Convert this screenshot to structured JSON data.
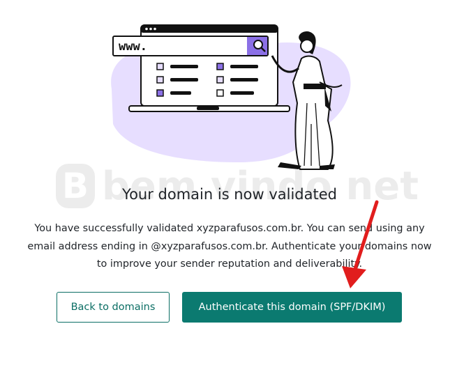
{
  "illustration": {
    "url_text": "www."
  },
  "watermark": {
    "logo_letter": "B",
    "text": "bem vindo net"
  },
  "headline": "Your domain is now validated",
  "description": "You have successfully validated xyzparafusos.com.br. You can send using any email address ending in @xyzparafusos.com.br. Authenticate your domains now to improve your sender reputation and deliverability.",
  "buttons": {
    "back_label": "Back to domains",
    "authenticate_label": "Authenticate this domain (SPF/DKIM)"
  },
  "colors": {
    "primary": "#0b7a70",
    "illustration_purple": "#8b70e6",
    "blob": "#e7deff",
    "annotation_arrow": "#e11d1d"
  }
}
